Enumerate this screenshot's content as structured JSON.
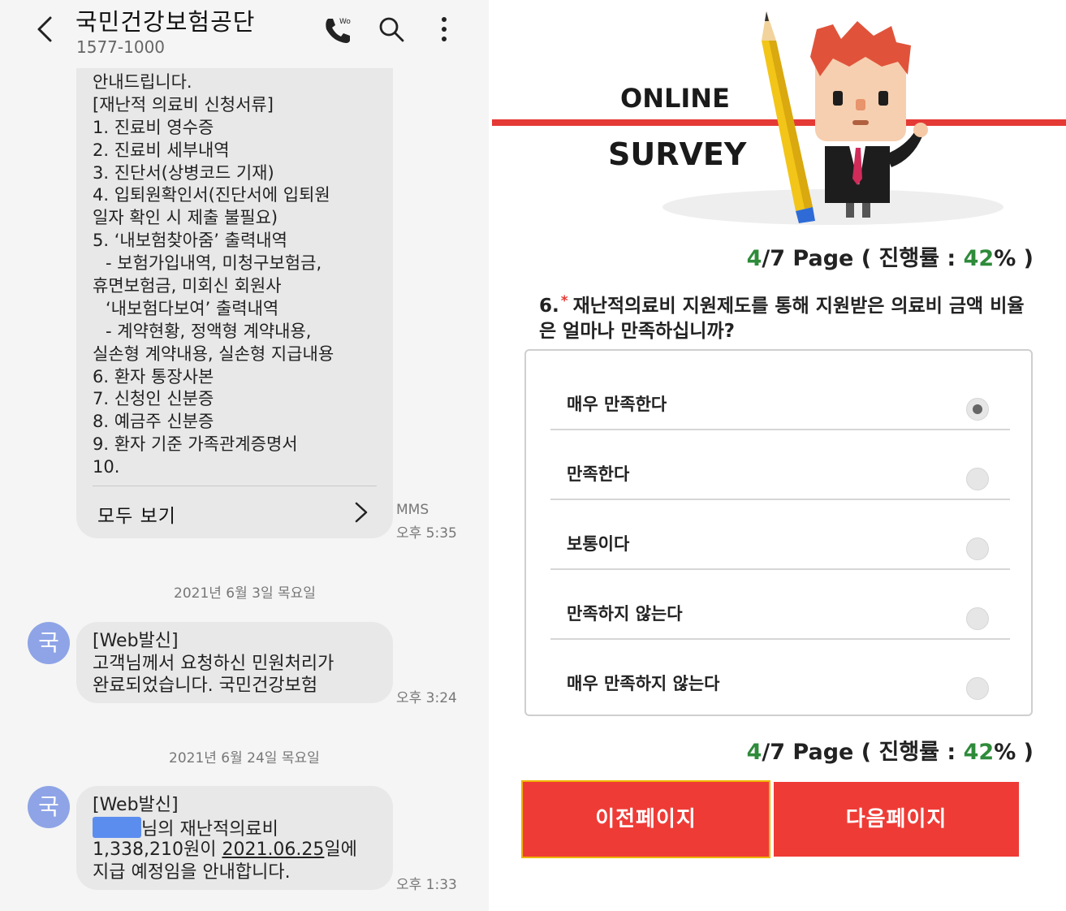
{
  "messages_screen": {
    "header": {
      "title": "국민건강보험공단",
      "number": "1577-1000",
      "call_icon": "phone-call-icon",
      "search_icon": "search-icon",
      "more_icon": "more-vertical-icon"
    },
    "mms": {
      "lines": [
        "안내드립니다.",
        "[재난적 의료비 신청서류]",
        "1. 진료비 영수증",
        "2. 진료비 세부내역",
        "3. 진단서(상병코드 기재)",
        "4. 입퇴원확인서(진단서에 입퇴원",
        "일자 확인 시 제출 불필요)",
        "5. ‘내보험찾아줌’ 출력내역",
        " - 보험가입내역, 미청구보험금,",
        "휴면보험금, 미회신 회원사",
        "‘내보험다보여’ 출력내역",
        " - 계약현황, 정액형 계약내용,",
        "실손형 계약내용, 실손형 지급내용",
        "6. 환자 통장사본",
        "7. 신청인 신분증",
        "8. 예금주 신분증",
        "9. 환자 기준 가족관계증명서",
        "10."
      ],
      "view_all": "모두 보기",
      "type": "MMS",
      "time": "오후 5:35"
    },
    "date_1": "2021년 6월 3일 목요일",
    "msg_2": {
      "avatar": "국",
      "line1": "[Web발신]",
      "line2": "고객님께서 요청하신 민원처리가",
      "line3": "완료되었습니다. 국민건강보험",
      "time": "오후 3:24"
    },
    "date_2": "2021년 6월 24일 목요일",
    "msg_3": {
      "avatar": "국",
      "line1": "[Web발신]",
      "line2_suffix": "님의 재난적의료비",
      "amount": "1,338,210원이",
      "date": "2021.06.25",
      "line3_suffix": "일에",
      "line4": "지급 예정임을 안내합니다.",
      "time": "오후 1:33"
    }
  },
  "survey": {
    "banner": {
      "word1": "ONLINE",
      "word2": "SURVEY",
      "accent_color": "#e53935"
    },
    "progress": {
      "current": "4",
      "total": "/7",
      "page_label": " Page ( 진행률 : ",
      "percent": "42",
      "percent_suffix": "% )"
    },
    "question": {
      "number": "6.",
      "required_mark": "*",
      "text": "재난적의료비 지원제도를 통해 지원받은 의료비 금액 비율은 얼마나 만족하십니까?"
    },
    "options": [
      {
        "label": "매우 만족한다",
        "selected": true
      },
      {
        "label": "만족한다",
        "selected": false
      },
      {
        "label": "보통이다",
        "selected": false
      },
      {
        "label": "만족하지 않는다",
        "selected": false
      },
      {
        "label": "매우 만족하지 않는다",
        "selected": false
      }
    ],
    "prev_button": "이전페이지",
    "next_button": "다음페이지",
    "button_color": "#ef3b36"
  }
}
